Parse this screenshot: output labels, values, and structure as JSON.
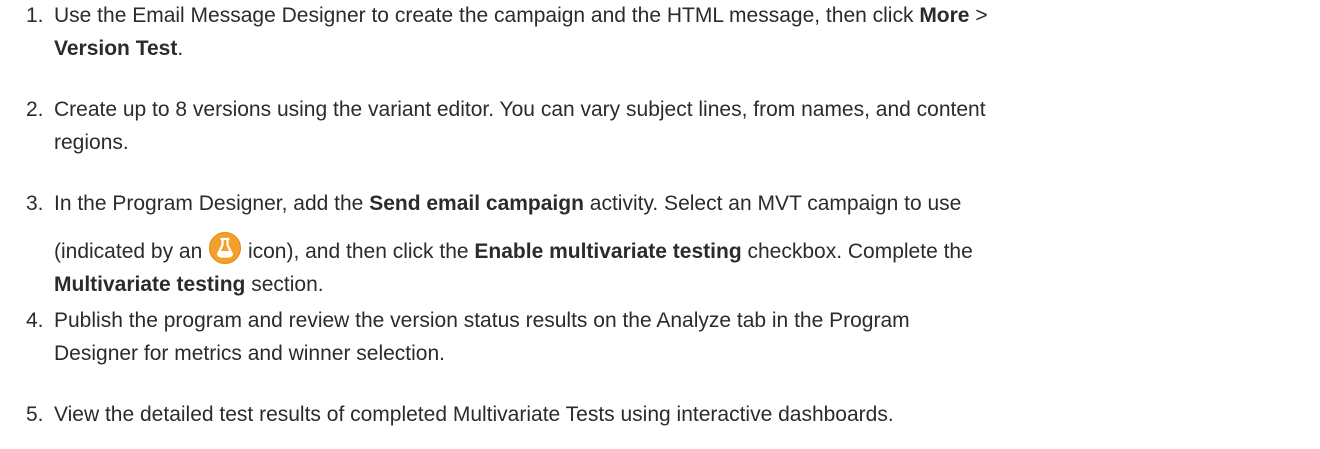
{
  "steps": [
    {
      "number": "1.",
      "t1": "Use the Email Message Designer to create the campaign and the HTML message, then click ",
      "b1": "More",
      "t2": " >",
      "b2": "Version Test",
      "t3": "."
    },
    {
      "number": "2.",
      "t1": "Create up to 8 versions using the variant editor. You can vary subject lines, from names, and content",
      "t2": "regions."
    },
    {
      "number": "3.",
      "t1": "In the Program Designer, add the ",
      "b1": "Send email campaign",
      "t2": " activity. Select an MVT campaign to use",
      "t3": "(indicated by an ",
      "icon": "mvt-flask-icon",
      "t4": " icon), and then click the ",
      "b2": "Enable multivariate testing",
      "t5": " checkbox. Complete the",
      "b3": "Multivariate testing",
      "t6": " section."
    },
    {
      "number": "4.",
      "t1": "Publish the program and review the version status results on the Analyze tab in the Program",
      "t2": "Designer for metrics and winner selection."
    },
    {
      "number": "5.",
      "t1": "View the detailed test results of completed Multivariate Tests using interactive dashboards."
    }
  ],
  "colors": {
    "text": "#2b2b2b",
    "icon_orange": "#f3a12a",
    "icon_orange_dark": "#e48c12"
  }
}
